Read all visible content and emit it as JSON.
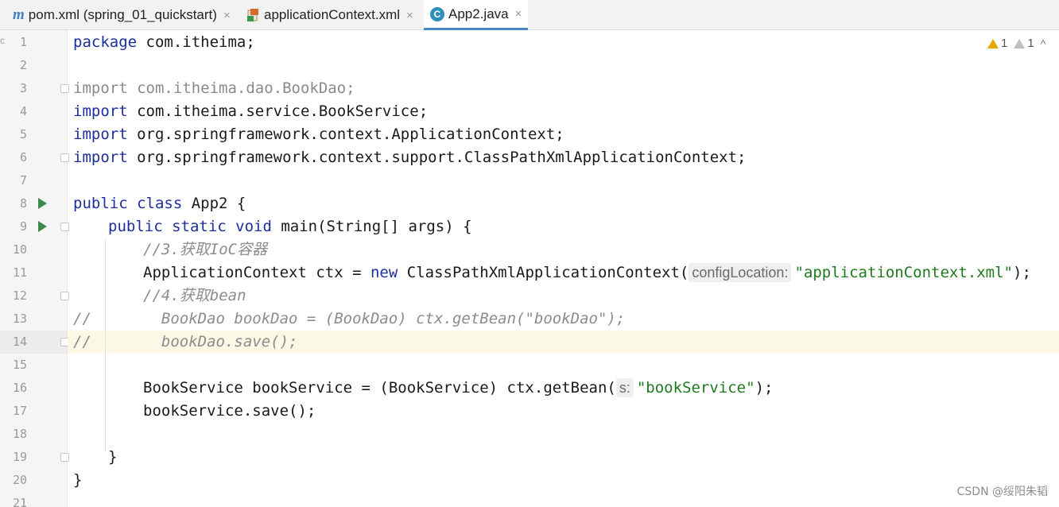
{
  "tabs": [
    {
      "label": "pom.xml (spring_01_quickstart)",
      "icon": "maven-m-icon",
      "active": false
    },
    {
      "label": "applicationContext.xml",
      "icon": "xml-file-icon",
      "active": false
    },
    {
      "label": "App2.java",
      "icon": "java-class-icon",
      "active": true
    }
  ],
  "tab_close_glyph": "×",
  "java_icon_glyph": "C",
  "maven_icon_glyph": "m",
  "inspections": {
    "warnings_count": "1",
    "weak_warnings_count": "1",
    "chevron": "^"
  },
  "fold_marker": "c",
  "line_numbers": [
    "1",
    "2",
    "3",
    "4",
    "5",
    "6",
    "7",
    "8",
    "9",
    "10",
    "11",
    "12",
    "13",
    "14",
    "15",
    "16",
    "17",
    "18",
    "19",
    "20",
    "21"
  ],
  "code": {
    "l1": {
      "kw": "package",
      "rest": " com.itheima;"
    },
    "l3": {
      "kw": "import",
      "rest": " com.itheima.dao.BookDao;"
    },
    "l4": {
      "kw": "import",
      "rest": " com.itheima.service.BookService;"
    },
    "l5": {
      "kw": "import",
      "rest": " org.springframework.context.ApplicationContext;"
    },
    "l6": {
      "kw": "import",
      "rest": " org.springframework.context.support.ClassPathXmlApplicationContext;"
    },
    "l8": {
      "kw": "public class",
      "rest": " App2 {"
    },
    "l9": {
      "kw": "public static void",
      "rest": " main(String[] args) {"
    },
    "l10": {
      "comment": "//3.获取IoC容器"
    },
    "l11": {
      "pre": "ApplicationContext ctx = ",
      "kw": "new",
      "mid": " ClassPathXmlApplicationContext(",
      "hint": "configLocation:",
      "str": "\"applicationContext.xml\"",
      "post": ");"
    },
    "l12": {
      "comment": "//4.获取bean"
    },
    "l13": {
      "prefix": "//",
      "comment": "BookDao bookDao = (BookDao) ctx.getBean(\"bookDao\");"
    },
    "l14": {
      "prefix": "//",
      "comment": "bookDao.save();"
    },
    "l16": {
      "pre": "BookService bookService = (BookService) ctx.getBean(",
      "hint": "s:",
      "str": "\"bookService\"",
      "post": ");"
    },
    "l17": {
      "pre": "bookService.save();"
    },
    "l19": {
      "pre": "}"
    },
    "l20": {
      "pre": "}"
    }
  },
  "watermark": "CSDN @绥阳朱韬"
}
